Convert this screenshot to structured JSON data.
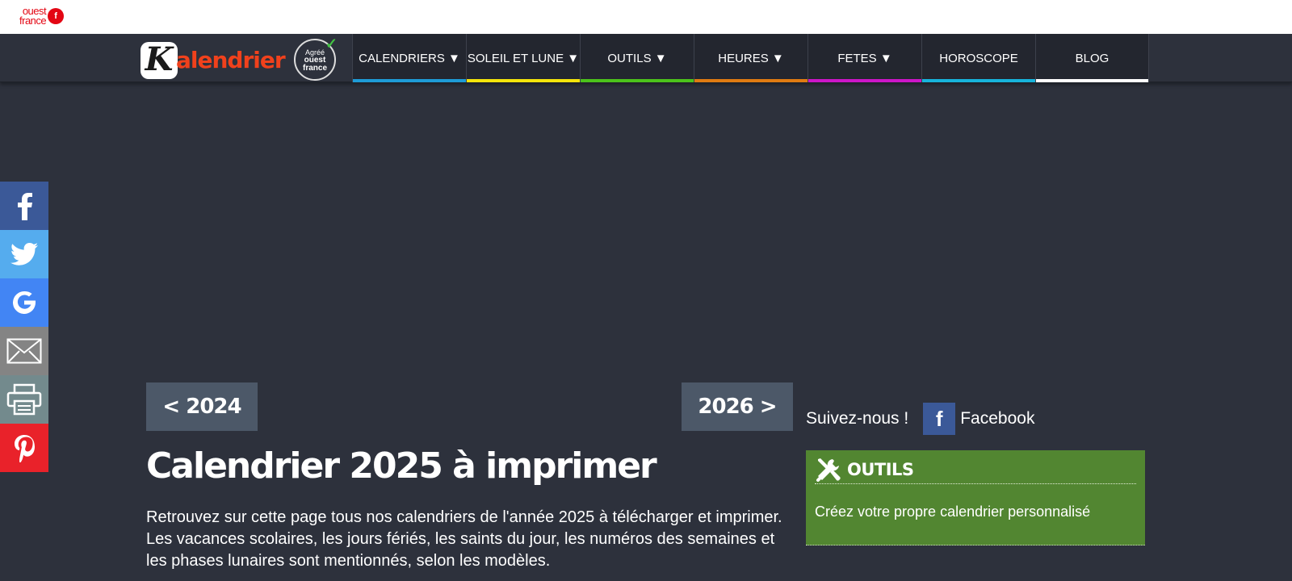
{
  "top_logo": {
    "line1": "ouest",
    "line2": "france",
    "mark": "f"
  },
  "brand": {
    "k": "K",
    "name": "alendrier",
    "agree_top": "Agréé",
    "agree_brand_1": "ouest",
    "agree_brand_2": "france"
  },
  "nav": {
    "items": [
      {
        "label": "CALENDRIERS ▼",
        "color": "#1e9cd7"
      },
      {
        "label": "SOLEIL ET LUNE ▼",
        "color": "#f5e50b"
      },
      {
        "label": "OUTILS ▼",
        "color": "#4cc31b"
      },
      {
        "label": "HEURES ▼",
        "color": "#e07b12"
      },
      {
        "label": "FETES ▼",
        "color": "#cc16c8"
      },
      {
        "label": "HOROSCOPE",
        "color": "#17b4dc"
      },
      {
        "label": "BLOG",
        "color": "#ffffff"
      }
    ]
  },
  "social": [
    {
      "name": "facebook",
      "color": "#3b5998"
    },
    {
      "name": "twitter",
      "color": "#55acee"
    },
    {
      "name": "google",
      "color": "#4285f4"
    },
    {
      "name": "email",
      "color": "#848484"
    },
    {
      "name": "print",
      "color": "#738a8d"
    },
    {
      "name": "pinterest",
      "color": "#e9222a"
    }
  ],
  "year_nav": {
    "prev": "< 2024",
    "next": "2026 >"
  },
  "page": {
    "title": "Calendrier 2025 à imprimer",
    "intro": "Retrouvez sur cette page tous nos calendriers de l'année 2025 à télécharger et imprimer. Les vacances scolaires, les jours fériés, les saints du jour, les numéros des semaines et les phases lunaires sont mentionnés, selon les modèles."
  },
  "follow": {
    "label": "Suivez-nous !",
    "facebook": "Facebook",
    "fb_letter": "f"
  },
  "tools_box": {
    "title": "OUTILS",
    "link": "Créez votre propre calendrier personnalisé"
  }
}
